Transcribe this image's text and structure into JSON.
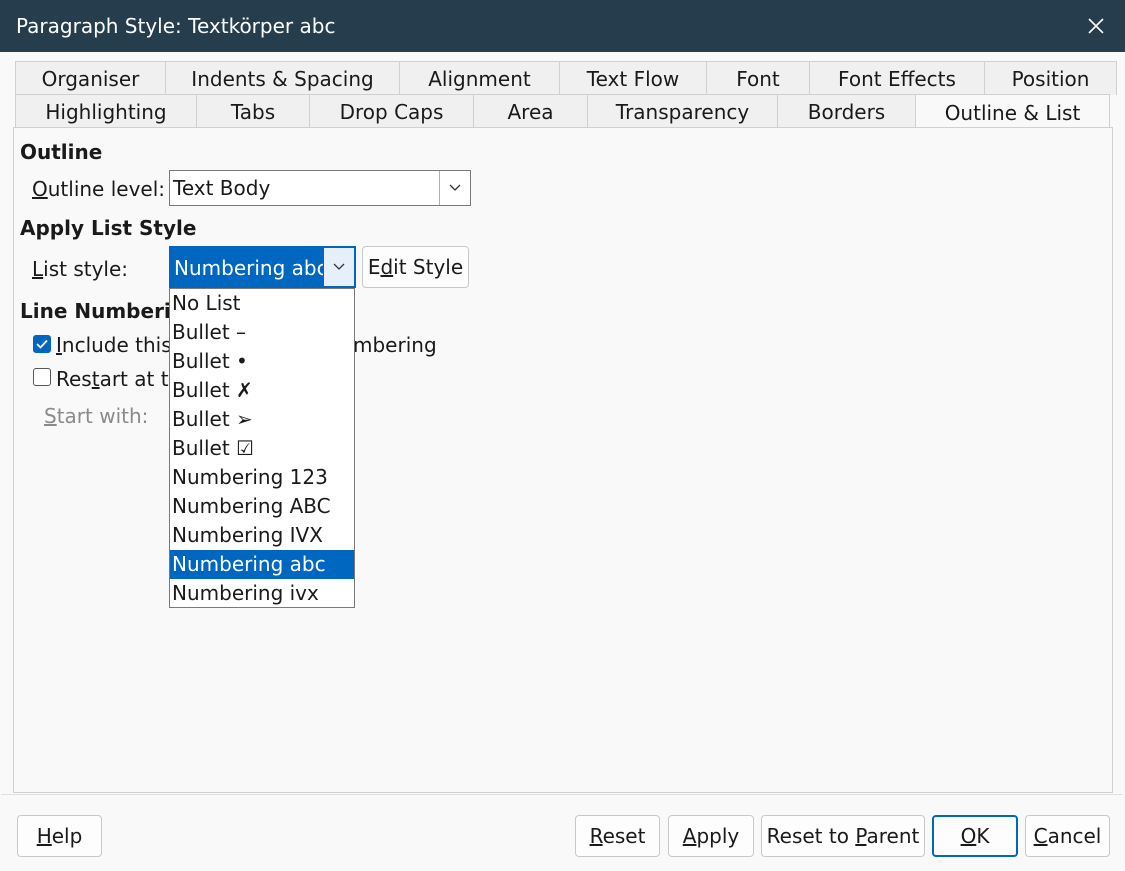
{
  "window": {
    "title": "Paragraph Style: Textkörper abc"
  },
  "tabs_row1": [
    "Organiser",
    "Indents & Spacing",
    "Alignment",
    "Text Flow",
    "Font",
    "Font Effects",
    "Position"
  ],
  "tabs_row2": [
    "Highlighting",
    "Tabs",
    "Drop Caps",
    "Area",
    "Transparency",
    "Borders",
    "Outline & List"
  ],
  "active_tab": "Outline & List",
  "outline": {
    "heading": "Outline",
    "level_label_pre": "",
    "level_label_u": "O",
    "level_label_post": "utline level:",
    "level_value": "Text Body"
  },
  "list_style": {
    "heading": "Apply List Style",
    "label_u": "L",
    "label_post": "ist style:",
    "value": "Numbering abc",
    "edit_pre": "E",
    "edit_u": "d",
    "edit_post": "it Style",
    "options": [
      "No List",
      "Bullet –",
      "Bullet •",
      "Bullet ✗",
      "Bullet ➢",
      "Bullet ☑",
      "Numbering 123",
      "Numbering ABC",
      "Numbering IVX",
      "Numbering abc",
      "Numbering ivx"
    ],
    "selected_index": 9
  },
  "line_numbering": {
    "heading": "Line Numbering",
    "include_u": "I",
    "include_pre": "nclude this",
    "include_tail": "mbering",
    "include_checked": true,
    "restart_pre": "Res",
    "restart_u": "t",
    "restart_post": "art at th",
    "restart_checked": false,
    "start_with_u": "S",
    "start_with_post": "tart with:"
  },
  "buttons": {
    "help_u": "H",
    "help_post": "elp",
    "reset_u": "R",
    "reset_post": "eset",
    "apply_u": "A",
    "apply_post": "pply",
    "reset_parent_pre": "Reset to ",
    "reset_parent_u": "P",
    "reset_parent_post": "arent",
    "ok_u": "O",
    "ok_post": "K",
    "cancel_u": "C",
    "cancel_post": "ancel"
  },
  "colors": {
    "titlebar": "#263d4d",
    "accent": "#0067c0"
  },
  "icons": {
    "close": "close-icon",
    "dropdown": "chevron-down-icon",
    "check": "check-icon"
  }
}
